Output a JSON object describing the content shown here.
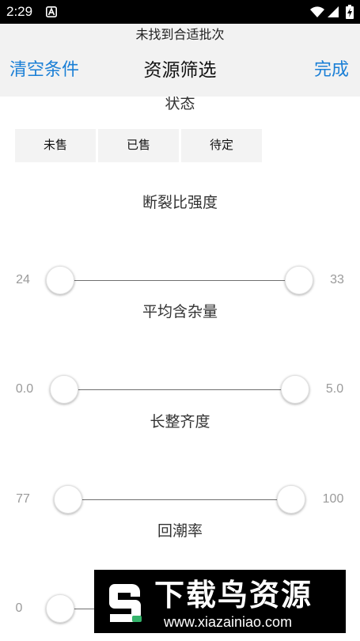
{
  "status_bar": {
    "time": "2:29",
    "icons": [
      "app-notification-icon",
      "wifi-icon",
      "cell-signal-icon",
      "battery-charging-icon"
    ]
  },
  "header": {
    "notice": "未找到合适批次",
    "clear_label": "清空条件",
    "title": "资源筛选",
    "done_label": "完成"
  },
  "filters": {
    "status": {
      "title": "状态",
      "options": [
        "未售",
        "已售",
        "待定"
      ]
    },
    "breaking_strength": {
      "title": "断裂比强度",
      "min_label": "24",
      "max_label": "33",
      "selected_low_fraction": 0,
      "selected_high_fraction": 1
    },
    "trash_content": {
      "title": "平均含杂量",
      "min_label": "0.0",
      "max_label": "5.0",
      "selected_low_fraction": 0,
      "selected_high_fraction": 1
    },
    "length_uniformity": {
      "title": "长整齐度",
      "min_label": "77",
      "max_label": "100",
      "selected_low_fraction": 0,
      "selected_high_fraction": 1
    },
    "moisture_regain": {
      "title": "回潮率",
      "min_label": "0",
      "selected_low_fraction": 0
    }
  },
  "watermark": {
    "brand": "下载鸟资源",
    "url": "www.xiazainiao.com"
  },
  "colors": {
    "accent": "#1a7fd6",
    "panel": "#f2f2f2",
    "chip": "#f3f3f3",
    "muted": "#9a9a9a"
  }
}
